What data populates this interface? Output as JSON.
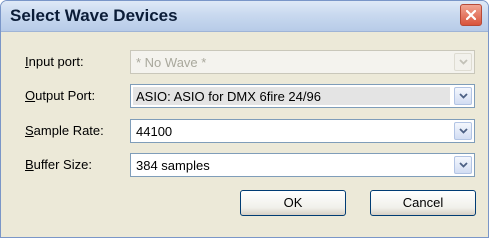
{
  "window": {
    "title": "Select Wave Devices",
    "close_icon": "close-icon"
  },
  "fields": {
    "input_port": {
      "label_u": "I",
      "label_rest": "nput port:",
      "value": "* No Wave *",
      "disabled": true
    },
    "output_port": {
      "label_u": "O",
      "label_rest": "utput Port:",
      "value": "ASIO: ASIO for DMX 6fire 24/96"
    },
    "sample_rate": {
      "label_u": "S",
      "label_rest": "ample Rate:",
      "value": "44100"
    },
    "buffer_size": {
      "label_u": "B",
      "label_rest": "uffer Size:",
      "value": "384 samples"
    }
  },
  "buttons": {
    "ok": "OK",
    "cancel": "Cancel"
  },
  "colors": {
    "titlebar": "#c9d9ef",
    "dialog_bg": "#ece9d8",
    "close_red": "#d9543b"
  }
}
